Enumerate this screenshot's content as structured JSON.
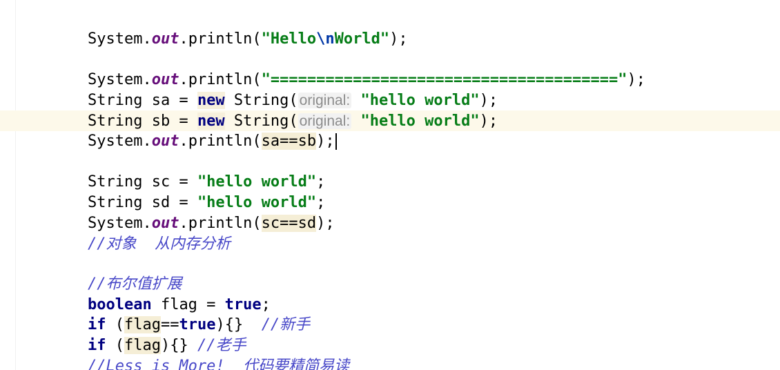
{
  "code": {
    "l1": {
      "a": "System.",
      "out": "out",
      "b": ".println(",
      "s1": "\"Hello",
      "esc": "\\n",
      "s2": "World\"",
      "c": ");"
    },
    "l2": {
      "a": "System.",
      "out": "out",
      "b": ".println(",
      "str": "\"======================================\"",
      "c": ");"
    },
    "l3": {
      "a": "String sa = ",
      "kw": "new",
      "b": " String(",
      "hint": "original:",
      "sp": " ",
      "str": "\"hello world\"",
      "c": ");"
    },
    "l4": {
      "a": "String sb = ",
      "kw": "new",
      "b": " String(",
      "hint": "original:",
      "sp": " ",
      "str": "\"hello world\"",
      "c": ");"
    },
    "l5": {
      "a": "System.",
      "out": "out",
      "b": ".println(",
      "expr": "sa==sb",
      "c": ");"
    },
    "l6": {
      "a": "String sc = ",
      "str": "\"hello world\"",
      "c": ";"
    },
    "l7": {
      "a": "String sd = ",
      "str": "\"hello world\"",
      "c": ";"
    },
    "l8": {
      "a": "System.",
      "out": "out",
      "b": ".println(",
      "expr": "sc==sd",
      "c": ");"
    },
    "l9": {
      "comment": "//对象  从内存分析"
    },
    "l10": {
      "comment": "//布尔值扩展"
    },
    "l11": {
      "kw": "boolean",
      "a": " flag = ",
      "kw2": "true",
      "c": ";"
    },
    "l12": {
      "kw": "if",
      "a": " (",
      "flag": "flag",
      "eq": "==",
      "kw2": "true",
      "b": "){}  ",
      "comment": "//新手"
    },
    "l13": {
      "kw": "if",
      "a": " (",
      "flag": "flag",
      "b": "){} ",
      "comment": "//老手"
    },
    "l14": {
      "comment": "//Less is More!  代码要精简易读"
    }
  },
  "colors": {
    "keyword": "#000080",
    "string": "#067d17",
    "static_field": "#660e7a",
    "comment": "#4848c8",
    "hint": "#8c8c8c",
    "current_line": "#fdf9ea",
    "usage_highlight": "#f5eed6"
  }
}
